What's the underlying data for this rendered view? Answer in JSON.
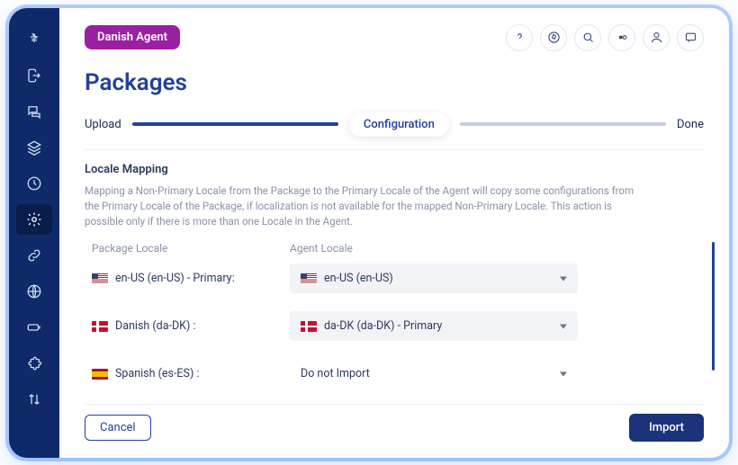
{
  "header": {
    "tag": "Danish Agent"
  },
  "page": {
    "title": "Packages"
  },
  "stepper": {
    "step1": "Upload",
    "step2": "Configuration",
    "step3": "Done"
  },
  "section": {
    "title": "Locale Mapping",
    "desc": "Mapping a Non-Primary Locale from the Package to the Primary Locale of the Agent will copy some configurations from the Primary Locale of the Package, if localization is not available for the mapped Non-Primary Locale. This action is possible only if there is more than one Locale in the Agent."
  },
  "columns": {
    "package": "Package Locale",
    "agent": "Agent Locale"
  },
  "rows": [
    {
      "pkg_flag": "us",
      "pkg_label": "en-US (en-US) - Primary:",
      "agent_flag": "us",
      "agent_label": "en-US (en-US)",
      "select_bg": true
    },
    {
      "pkg_flag": "dk",
      "pkg_label": "Danish (da-DK) :",
      "agent_flag": "dk",
      "agent_label": "da-DK (da-DK) - Primary",
      "select_bg": true
    },
    {
      "pkg_flag": "es",
      "pkg_label": "Spanish (es-ES) :",
      "agent_flag": "",
      "agent_label": "Do not Import",
      "select_bg": false
    }
  ],
  "footer": {
    "cancel": "Cancel",
    "import": "Import"
  },
  "sidebar_icons": [
    "pin",
    "exit",
    "chat",
    "layers",
    "clock",
    "gear",
    "link",
    "globe",
    "battery",
    "puzzle",
    "sort"
  ],
  "topbar_icons": [
    "help",
    "compass",
    "search",
    "toggle",
    "user",
    "message"
  ]
}
